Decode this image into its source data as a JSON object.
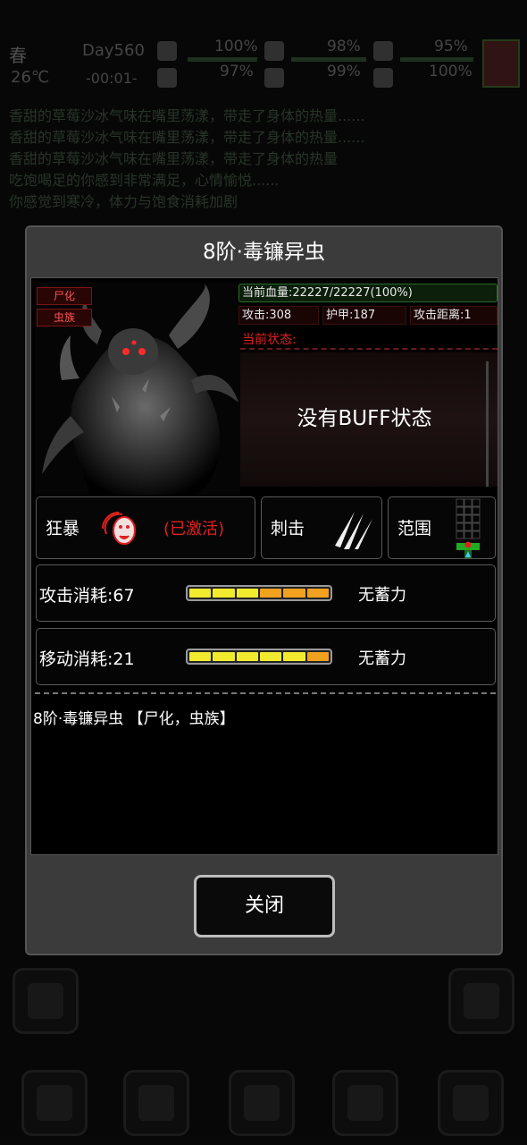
{
  "hud": {
    "season": "春",
    "temperature": "26℃",
    "day": "Day560",
    "time": "-00:01-",
    "stats": [
      "100%",
      "98%",
      "95%",
      "97%",
      "99%",
      "100%"
    ]
  },
  "log_lines": [
    "香甜的草莓沙冰气味在嘴里荡漾，带走了身体的热量......",
    "香甜的草莓沙冰气味在嘴里荡漾，带走了身体的热量......",
    "香甜的草莓沙冰气味在嘴里荡漾，带走了身体的热量",
    "吃饱喝足的你感到非常满足，心情愉悦......",
    "你感觉到寒冷，体力与饱食消耗加剧"
  ],
  "dialog": {
    "title": "8阶·毒镰异虫",
    "tags": [
      "尸化",
      "虫族"
    ],
    "hp_text": "当前血量:22227/22227(100%)",
    "attack": "攻击:308",
    "armor": "护甲:187",
    "range": "攻击距离:1",
    "state_label": "当前状态:",
    "buff_text": "没有BUFF状态",
    "skills": {
      "berserk_label": "狂暴",
      "berserk_state": "(已激活)",
      "stab_label": "刺击",
      "area_label": "范围"
    },
    "attack_cost": {
      "label": "攻击消耗:67",
      "charge": "无蓄力",
      "segments_yellow": 3,
      "segments_total": 6
    },
    "move_cost": {
      "label": "移动消耗:21",
      "charge": "无蓄力",
      "segments_yellow": 5,
      "segments_total": 6
    },
    "description": "8阶·毒镰异虫 【尸化，虫族】",
    "close_label": "关闭"
  },
  "colors": {
    "accent_red": "#e02020",
    "hp_border": "#2e6a2e",
    "bar_yellow": "#f2ea2e",
    "bar_orange": "#f2a11e"
  }
}
